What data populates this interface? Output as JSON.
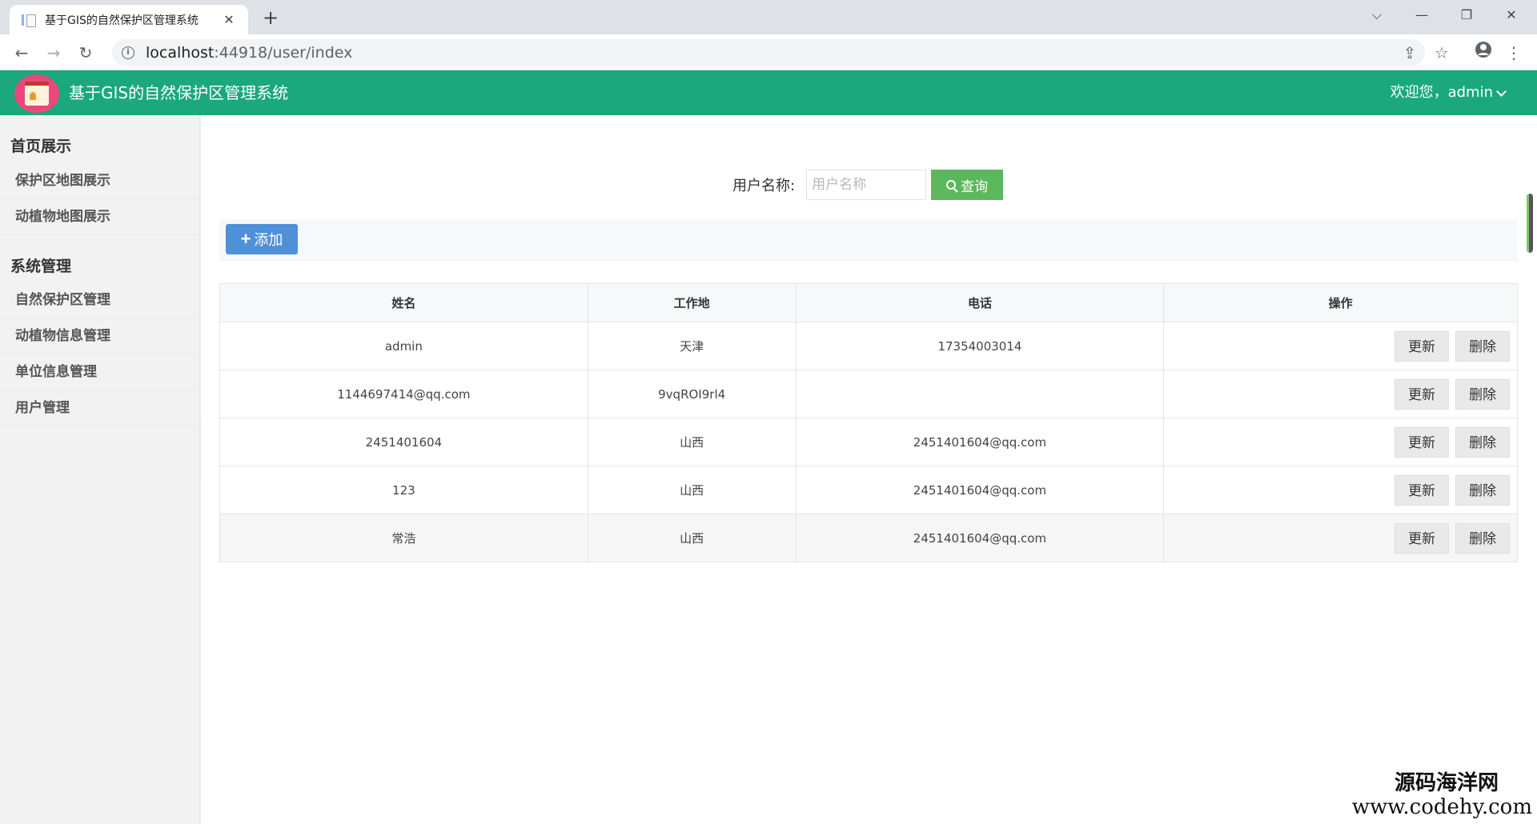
{
  "browser": {
    "tab_title": "基于GIS的自然保护区管理系统",
    "tab_close": "✕",
    "new_tab": "+",
    "url_host": "localhost",
    "url_rest": ":44918/user/index"
  },
  "header": {
    "title": "基于GIS的自然保护区管理系统",
    "welcome": "欢迎您，admin"
  },
  "sidebar": {
    "group1": "首页展示",
    "group1_items": [
      "保护区地图展示",
      "动植物地图展示"
    ],
    "group2": "系统管理",
    "group2_items": [
      "自然保护区管理",
      "动植物信息管理",
      "单位信息管理",
      "用户管理"
    ]
  },
  "search": {
    "label": "用户名称:",
    "placeholder": "用户名称",
    "button": "查询"
  },
  "actions": {
    "add": "添加"
  },
  "table": {
    "columns": [
      "姓名",
      "工作地",
      "电话",
      "操作"
    ],
    "update_label": "更新",
    "delete_label": "删除",
    "rows": [
      {
        "name": "admin",
        "place": "天津",
        "phone": "17354003014"
      },
      {
        "name": "1144697414@qq.com",
        "place": "9vqROI9rl4",
        "phone": ""
      },
      {
        "name": "2451401604",
        "place": "山西",
        "phone": "2451401604@qq.com"
      },
      {
        "name": "123",
        "place": "山西",
        "phone": "2451401604@qq.com"
      },
      {
        "name": "常浩",
        "place": "山西",
        "phone": "2451401604@qq.com"
      }
    ]
  },
  "watermark": {
    "line1": "源码海洋网",
    "line2": "www.codehy.com"
  },
  "icons": {
    "back": "←",
    "forward": "→",
    "reload": "↻",
    "share": "⇪",
    "star": "☆",
    "menu": "⋮",
    "info": "i",
    "win_dropdown": "⌵",
    "win_min": "—",
    "win_restore": "❐",
    "win_close": "✕"
  }
}
